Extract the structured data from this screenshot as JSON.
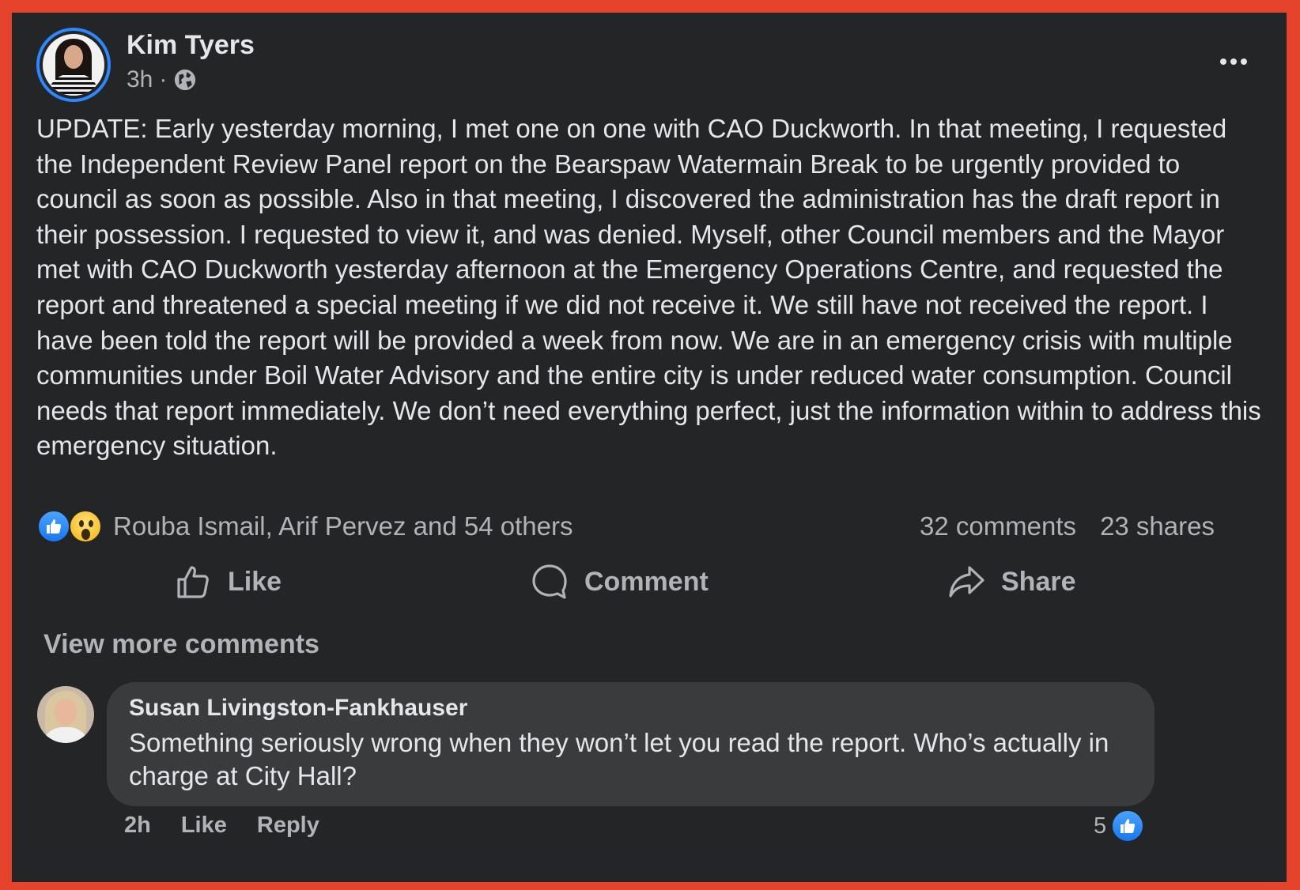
{
  "post": {
    "author": "Kim Tyers",
    "time": "3h",
    "separator": "·",
    "audience_icon": "globe-icon",
    "text": "UPDATE: Early yesterday morning, I met one on one with CAO Duckworth. In that meeting, I requested the Independent Review Panel report on the Bearspaw Watermain Break to be urgently provided to council as soon as possible. Also in that meeting, I discovered the administration has the draft report in their possession. I requested to view it, and was denied. Myself, other Council members and the Mayor met with CAO Duckworth yesterday afternoon at the Emergency Operations Centre, and requested the report and threatened a special meeting if we did not receive it. We still have not received the report. I have been told the report will be provided a week from now. We are in an emergency crisis with multiple communities under Boil Water Advisory and the entire city is under reduced water consumption. Council needs that report immediately. We don’t need everything perfect, just the information within to address this emergency situation."
  },
  "reactions": {
    "icons": [
      "like-reaction-icon",
      "wow-reaction-icon"
    ],
    "names": "Rouba Ismail, Arif Pervez and 54 others",
    "comments": "32 comments",
    "shares": "23 shares"
  },
  "actions": {
    "like": "Like",
    "comment": "Comment",
    "share": "Share"
  },
  "view_more": "View more comments",
  "comment": {
    "author": "Susan Livingston-Fankhauser",
    "text": "Something seriously wrong when they won’t let you read the report. Who’s actually in charge at City Hall?",
    "time": "2h",
    "like": "Like",
    "reply": "Reply",
    "reaction_count": "5"
  },
  "colors": {
    "background": "#242526",
    "border": "#e5432c",
    "accent": "#1877f2",
    "bubble": "#3a3b3c",
    "secondary_text": "#b0b3b8"
  }
}
